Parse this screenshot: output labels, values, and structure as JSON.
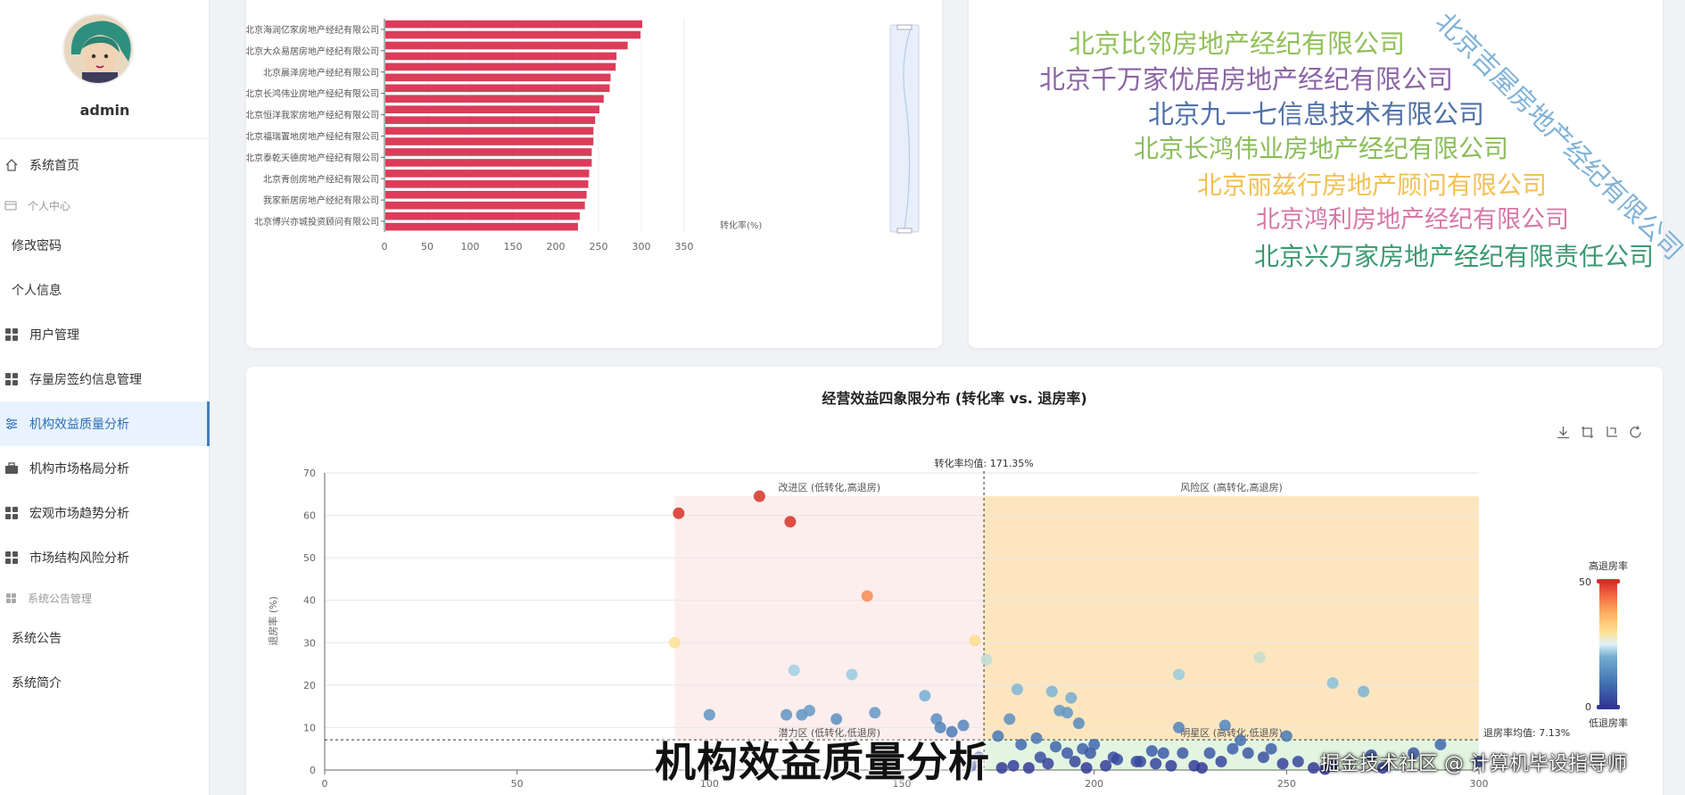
{
  "sidebar": {
    "username": "admin",
    "items": [
      {
        "label": "系统首页",
        "icon": "home-icon",
        "type": "item"
      },
      {
        "label": "个人中心",
        "icon": "user-card-icon",
        "type": "group"
      },
      {
        "label": "修改密码",
        "type": "sub"
      },
      {
        "label": "个人信息",
        "type": "sub"
      },
      {
        "label": "用户管理",
        "icon": "grid-icon",
        "type": "item"
      },
      {
        "label": "存量房签约信息管理",
        "icon": "grid-icon",
        "type": "item"
      },
      {
        "label": "机构效益质量分析",
        "icon": "sliders-icon",
        "type": "item",
        "active": true
      },
      {
        "label": "机构市场格局分析",
        "icon": "briefcase-icon",
        "type": "item"
      },
      {
        "label": "宏观市场趋势分析",
        "icon": "grid-icon",
        "type": "item"
      },
      {
        "label": "市场结构风险分析",
        "icon": "grid-icon",
        "type": "item"
      },
      {
        "label": "系统公告管理",
        "icon": "grid-icon",
        "type": "group"
      },
      {
        "label": "系统公告",
        "type": "sub"
      },
      {
        "label": "系统简介",
        "type": "sub"
      }
    ]
  },
  "bar_chart": {
    "type": "bar",
    "orientation": "horizontal",
    "categories": [
      "北京海润亿家房地产经纪有限公司",
      "北京大众易居房地产经纪有限公司",
      "北京晨泽房地产经纪有限公司",
      "北京长鸿伟业房地产经纪有限公司",
      "北京恒洋我家房地产经纪有限公司",
      "北京福瑞置地房地产经纪有限公司",
      "北京泰乾天德房地产经纪有限公司",
      "北京青创房地产经纪有限公司",
      "我家新居房地产经纪有限公司",
      "北京博兴亦城投资顾问有限公司"
    ],
    "series": [
      {
        "values": [
          300,
          298,
          283,
          270,
          269,
          263,
          262,
          255,
          250,
          245,
          243,
          243,
          241,
          241,
          238,
          237,
          235,
          233,
          227,
          225
        ]
      }
    ],
    "xticks": [
      "0",
      "50",
      "100",
      "150",
      "200",
      "250",
      "300",
      "350"
    ],
    "xlim": [
      0,
      350
    ],
    "xlabel": "转化率(%)",
    "color": "#dc3c5a"
  },
  "word_cloud": {
    "words": [
      {
        "text": "北京比邻房地产经纪有限公司",
        "color": "#91c05a"
      },
      {
        "text": "北京千万家优居房地产经纪有限公司",
        "color": "#8b64a4"
      },
      {
        "text": "北京九一七信息技术有限公司",
        "color": "#4f70a8"
      },
      {
        "text": "北京长鸿伟业房地产经纪有限公司",
        "color": "#8bbd5a"
      },
      {
        "text": "北京丽兹行房地产顾问有限公司",
        "color": "#f2c055"
      },
      {
        "text": "北京鸿利房地产经纪有限公司",
        "color": "#d678a8"
      },
      {
        "text": "北京兴万家房地产经纪有限责任公司",
        "color": "#3a9a72"
      },
      {
        "text": "北京吉屋房地产经纪有限公司",
        "color": "#7fb2d8"
      }
    ]
  },
  "chart_data": {
    "type": "scatter",
    "title": "经营效益四象限分布 (转化率 vs. 退房率)",
    "xlim": [
      0,
      300
    ],
    "ylim": [
      0,
      70
    ],
    "xticks": [
      "0",
      "50",
      "100",
      "150",
      "200",
      "250",
      "300"
    ],
    "yticks": [
      "0",
      "10",
      "20",
      "30",
      "40",
      "50",
      "60",
      "70"
    ],
    "ylabel": "退房率 (%)",
    "x_mean_label": "转化率均值: 171.35%",
    "y_mean_label": "退房率均值: 7.13%",
    "x_mean": 171.35,
    "y_mean": 7.13,
    "quadrants": [
      {
        "label": "改进区 (低转化,高退房)",
        "color": "#fdecec"
      },
      {
        "label": "风险区 (高转化,高退房)",
        "color": "#fde3b8"
      },
      {
        "label": "潜力区 (低转化,低退房)",
        "color": "#ffffff"
      },
      {
        "label": "明星区 (高转化,低退房)",
        "color": "#e3f5e1"
      }
    ],
    "visual_map": {
      "title": "高退房率",
      "bottom_title": "低退房率",
      "max": "50",
      "min": "0"
    },
    "points": [
      [
        113,
        64.5
      ],
      [
        92,
        60.5
      ],
      [
        121,
        58.5
      ],
      [
        141,
        41
      ],
      [
        91,
        30
      ],
      [
        169,
        30.5
      ],
      [
        172,
        26
      ],
      [
        122,
        23.5
      ],
      [
        137,
        22.5
      ],
      [
        222,
        22.5
      ],
      [
        243,
        26.5
      ],
      [
        262,
        20.5
      ],
      [
        270,
        18.5
      ],
      [
        100,
        13
      ],
      [
        120,
        13
      ],
      [
        124,
        13
      ],
      [
        126,
        14
      ],
      [
        133,
        12
      ],
      [
        143,
        13.5
      ],
      [
        156,
        17.5
      ],
      [
        159,
        12
      ],
      [
        160,
        10
      ],
      [
        163,
        9
      ],
      [
        166,
        10.5
      ],
      [
        178,
        12
      ],
      [
        180,
        19
      ],
      [
        189,
        18.5
      ],
      [
        191,
        14
      ],
      [
        193,
        13.5
      ],
      [
        194,
        17
      ],
      [
        196,
        11
      ],
      [
        197,
        5
      ],
      [
        175,
        8
      ],
      [
        181,
        6
      ],
      [
        185,
        7.5
      ],
      [
        190,
        5.5
      ],
      [
        193,
        4
      ],
      [
        195,
        2
      ],
      [
        199,
        4
      ],
      [
        200,
        6
      ],
      [
        203,
        1
      ],
      [
        205,
        3
      ],
      [
        211,
        2
      ],
      [
        212,
        2
      ],
      [
        216,
        1.5
      ],
      [
        218,
        4
      ],
      [
        220,
        1
      ],
      [
        222,
        10
      ],
      [
        223,
        4
      ],
      [
        226,
        1
      ],
      [
        230,
        4
      ],
      [
        234,
        10.5
      ],
      [
        236,
        5
      ],
      [
        238,
        7
      ],
      [
        240,
        4
      ],
      [
        244,
        3
      ],
      [
        250,
        8
      ],
      [
        253,
        2
      ],
      [
        257,
        0.5
      ],
      [
        262,
        1
      ],
      [
        272,
        3.5
      ],
      [
        283,
        4
      ],
      [
        290,
        6
      ],
      [
        300,
        2
      ],
      [
        168,
        1
      ],
      [
        170,
        3
      ],
      [
        176,
        0.5
      ],
      [
        179,
        1
      ],
      [
        183,
        0.5
      ],
      [
        186,
        3
      ],
      [
        188,
        1.5
      ],
      [
        198,
        0.5
      ],
      [
        206,
        2.5
      ],
      [
        215,
        4.5
      ],
      [
        228,
        0.5
      ],
      [
        233,
        2
      ],
      [
        246,
        5
      ],
      [
        249,
        1.5
      ],
      [
        260,
        0.2
      ],
      [
        275,
        0.5
      ]
    ]
  },
  "toolbox": {
    "icons": [
      "download-icon",
      "zoom-icon",
      "zoom-reset-icon",
      "restore-icon"
    ]
  },
  "overlay": {
    "caption": "机构效益质量分析",
    "watermark": "掘金技术社区 @ 计算机毕设指导师"
  }
}
